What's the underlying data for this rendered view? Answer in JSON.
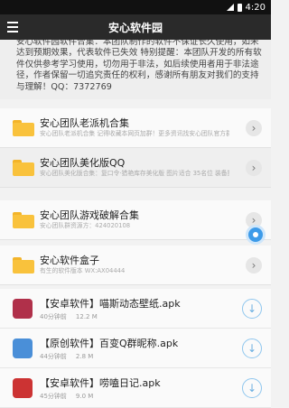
{
  "status": {
    "time": "4:20"
  },
  "appbar": {
    "title": "安心软件园"
  },
  "notice": {
    "text": "安心软件园软件合集：本团队制作的软件不保证长久使用，如未达到预期效果，代表软件已失效 特别提醒：本团队开发的所有软件仅供参考学习使用，切勿用于非法，如后续使用者用于非法途径，作者保留一切追究责任的权利，感谢所有朋友对我们的支持与理解！QQ：7372769"
  },
  "folders": [
    {
      "name": "安心团队老派机合集",
      "desc": "安心团队老派机合集 记得收藏本网页加群！更多资讯找安心团队官方群：4540201..."
    },
    {
      "name": "安心团队美化版QQ",
      "desc": "安心团队美化版合集：复口令·猎艳库存美化版 图片适合 35名位 装备搜索系统资源..."
    },
    {
      "name": "安心团队游戏破解合集",
      "desc": "安心团队群资源方：424020108"
    },
    {
      "name": "安心软件盒子",
      "desc": "有生的软件版本 WX:AX04444"
    }
  ],
  "apks": [
    {
      "name": "【安卓软件】喵斯动态壁纸.apk",
      "time": "40分钟前",
      "size": "12.2 M",
      "icon_color": "#b0304a"
    },
    {
      "name": "【原创软件】百变Q群昵称.apk",
      "time": "44分钟前",
      "size": "2.8 M",
      "icon_color": "#4a8fd8"
    },
    {
      "name": "【安卓软件】唠嗑日记.apk",
      "time": "45分钟前",
      "size": "9.0 M",
      "icon_color": "#cc3333"
    }
  ]
}
